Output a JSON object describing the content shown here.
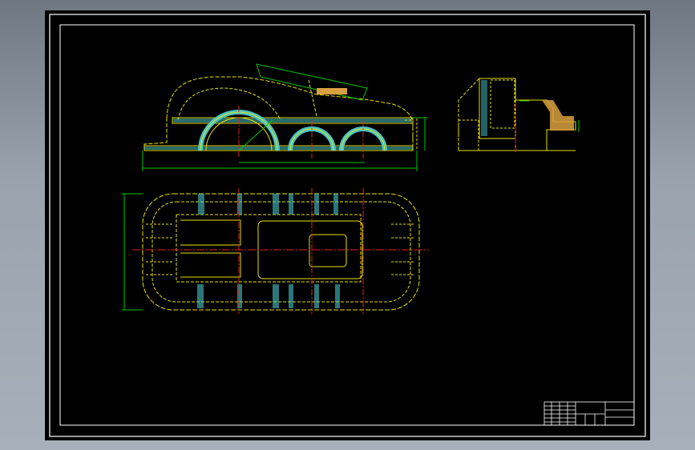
{
  "window": {
    "title": ""
  },
  "drawing": {
    "views": [
      "front-section-view",
      "side-section-view",
      "top-view"
    ],
    "title_block": {
      "text": ""
    }
  },
  "colors": {
    "background": "#000000",
    "frame": "#ffffff",
    "outline": "#e8e000",
    "hatch": "#49c4c9",
    "dimension": "#00c800",
    "centerline": "#e02020",
    "section_fill": "#d8a040",
    "chrome": "#a7b0ba"
  }
}
